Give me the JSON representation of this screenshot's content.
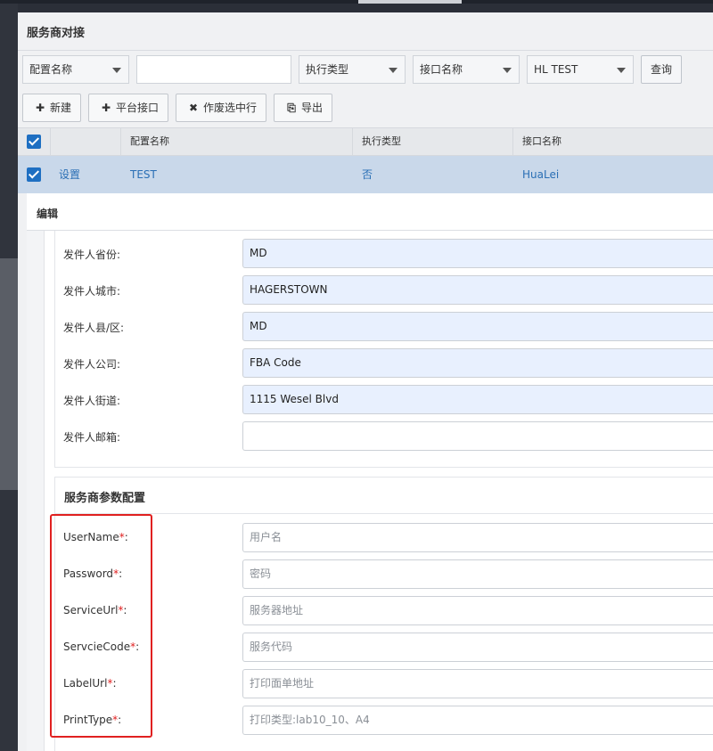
{
  "page": {
    "title": "服务商对接",
    "filters": {
      "config_name": "配置名称",
      "config_name_value": "",
      "exec_type": "执行类型",
      "api_name": "接口名称",
      "provider": "HL TEST",
      "query": "查询"
    },
    "toolbar": {
      "new_icon": "✚",
      "new": "新建",
      "platform_icon": "✚",
      "platform": "平台接口",
      "void_icon": "✖",
      "void": "作废选中行",
      "export_icon": "⎘",
      "export": "导出"
    },
    "table": {
      "headers": [
        "配置名称",
        "执行类型",
        "接口名称"
      ],
      "row": {
        "action": "设置",
        "config_name": "TEST",
        "exec_type": "否",
        "api_name": "HuaLei"
      }
    }
  },
  "modal": {
    "title": "编辑",
    "sender_fields": [
      {
        "label": "发件人省份:",
        "value": "MD"
      },
      {
        "label": "发件人城市:",
        "value": "HAGERSTOWN"
      },
      {
        "label": "发件人县/区:",
        "value": "MD"
      },
      {
        "label": "发件人公司:",
        "value": "FBA Code"
      },
      {
        "label": "发件人街道:",
        "value": "1115 Wesel Blvd"
      },
      {
        "label": "发件人邮箱:",
        "value": ""
      }
    ],
    "provider_section": {
      "title": "服务商参数配置",
      "fields": [
        {
          "label": "UserName",
          "req": "*",
          "colon": ":",
          "placeholder": "用户名"
        },
        {
          "label": "Password",
          "req": "*",
          "colon": ":",
          "placeholder": "密码"
        },
        {
          "label": "ServiceUrl",
          "req": "*",
          "colon": ":",
          "placeholder": "服务器地址"
        },
        {
          "label": "ServcieCode",
          "req": "*",
          "colon": ":",
          "placeholder": "服务代码"
        },
        {
          "label": "LabelUrl",
          "req": "*",
          "colon": ":",
          "placeholder": "打印面单地址"
        },
        {
          "label": "PrintType",
          "req": "*",
          "colon": ":",
          "placeholder": "打印类型:lab10_10、A4"
        }
      ]
    }
  },
  "colors": {
    "accent": "#1e6fc2",
    "required": "#e02020",
    "autofill": "#e8f0fe"
  }
}
